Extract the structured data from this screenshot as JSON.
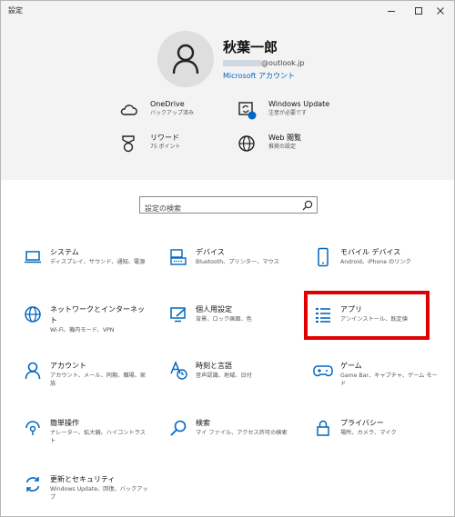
{
  "window": {
    "title": "設定"
  },
  "user": {
    "name": "秋葉一郎",
    "email_domain": "@outlook.jp",
    "account_link": "Microsoft アカウント"
  },
  "header_items": [
    {
      "id": "onedrive",
      "label": "OneDrive",
      "sub": "バックアップ済み",
      "icon": "cloud-icon"
    },
    {
      "id": "windows-update",
      "label": "Windows Update",
      "sub": "注意が必要です",
      "icon": "update-icon"
    },
    {
      "id": "rewards",
      "label": "リワード",
      "sub": "75 ポイント",
      "icon": "medal-icon"
    },
    {
      "id": "web-browsing",
      "label": "Web 閲覧",
      "sub": "推奨の設定",
      "icon": "globe-icon"
    }
  ],
  "search": {
    "placeholder": "設定の検索"
  },
  "categories": [
    {
      "label": "システム",
      "sub": "ディスプレイ、サウンド、通知、電源",
      "icon": "laptop-icon"
    },
    {
      "label": "デバイス",
      "sub": "Bluetooth、プリンター、マウス",
      "icon": "keyboard-icon"
    },
    {
      "label": "モバイル デバイス",
      "sub": "Android、iPhone のリンク",
      "icon": "phone-icon"
    },
    {
      "label": "ネットワークとインターネット",
      "sub": "Wi-Fi、機内モード、VPN",
      "icon": "globe-icon"
    },
    {
      "label": "個人用設定",
      "sub": "背景、ロック画面、色",
      "icon": "personalization-icon"
    },
    {
      "label": "アプリ",
      "sub": "アンインストール、既定値",
      "icon": "apps-list-icon"
    },
    {
      "label": "アカウント",
      "sub": "アカウント、メール、同期、職場、家族",
      "icon": "person-icon"
    },
    {
      "label": "時刻と言語",
      "sub": "音声認識、地域、日付",
      "icon": "time-language-icon"
    },
    {
      "label": "ゲーム",
      "sub": "Game Bar、キャプチャ、ゲーム モード",
      "icon": "gamepad-icon"
    },
    {
      "label": "簡単操作",
      "sub": "ナレーター、拡大鏡、ハイコントラスト",
      "icon": "ease-of-access-icon"
    },
    {
      "label": "検索",
      "sub": "マイ ファイル、アクセス許可の検索",
      "icon": "search-icon"
    },
    {
      "label": "プライバシー",
      "sub": "場所、カメラ、マイク",
      "icon": "lock-icon"
    },
    {
      "label": "更新とセキュリティ",
      "sub": "Windows Update、回復、バックアップ",
      "icon": "sync-icon"
    }
  ],
  "colors": {
    "accent": "#0067c0",
    "highlight": "#e00000",
    "header_bg": "#f3f3f3"
  }
}
